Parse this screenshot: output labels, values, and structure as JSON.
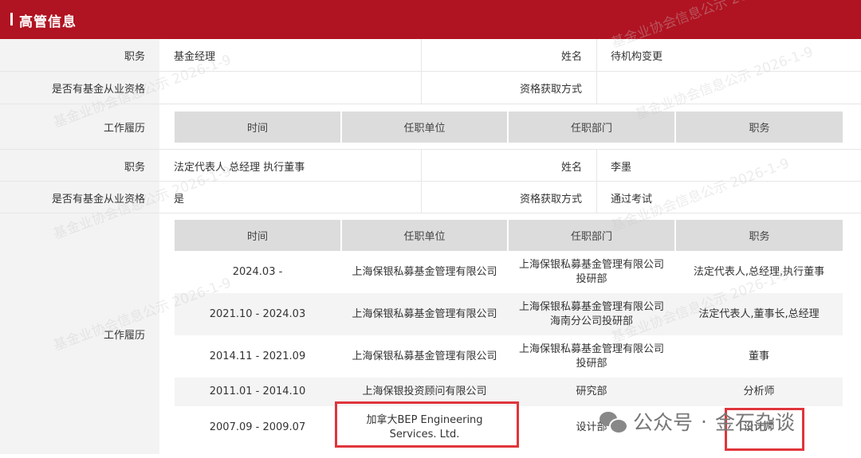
{
  "header": {
    "title": "高管信息"
  },
  "labels": {
    "position": "职务",
    "name": "姓名",
    "qualified": "是否有基金从业资格",
    "method": "资格获取方式",
    "history": "工作履历"
  },
  "table_headers": [
    "时间",
    "任职单位",
    "任职部门",
    "职务"
  ],
  "person1": {
    "position": "基金经理",
    "name": "待机构变更",
    "qualified": "",
    "method": ""
  },
  "person2": {
    "position": "法定代表人 总经理 执行董事",
    "name": "李墨",
    "qualified": "是",
    "method": "通过考试",
    "history": [
      {
        "time": "2024.03 -",
        "company": "上海保银私募基金管理有限公司",
        "dept": "上海保银私募基金管理有限公司投研部",
        "role": "法定代表人,总经理,执行董事"
      },
      {
        "time": "2021.10 - 2024.03",
        "company": "上海保银私募基金管理有限公司",
        "dept": "上海保银私募基金管理有限公司海南分公司投研部",
        "role": "法定代表人,董事长,总经理"
      },
      {
        "time": "2014.11 - 2021.09",
        "company": "上海保银私募基金管理有限公司",
        "dept": "上海保银私募基金管理有限公司投研部",
        "role": "董事"
      },
      {
        "time": "2011.01 - 2014.10",
        "company": "上海保银投资顾问有限公司",
        "dept": "研究部",
        "role": "分析师"
      },
      {
        "time": "2007.09 - 2009.07",
        "company": "加拿大BEP Engineering Services. Ltd.",
        "dept": "设计部",
        "role": "设计师"
      }
    ]
  },
  "watermark": "基金业协会信息公示 2026-1-9",
  "wechat": {
    "label": "公众号",
    "separator": "·",
    "account": "金石杂谈"
  },
  "colors": {
    "header": "#b01321",
    "highlight": "#e0353b"
  }
}
